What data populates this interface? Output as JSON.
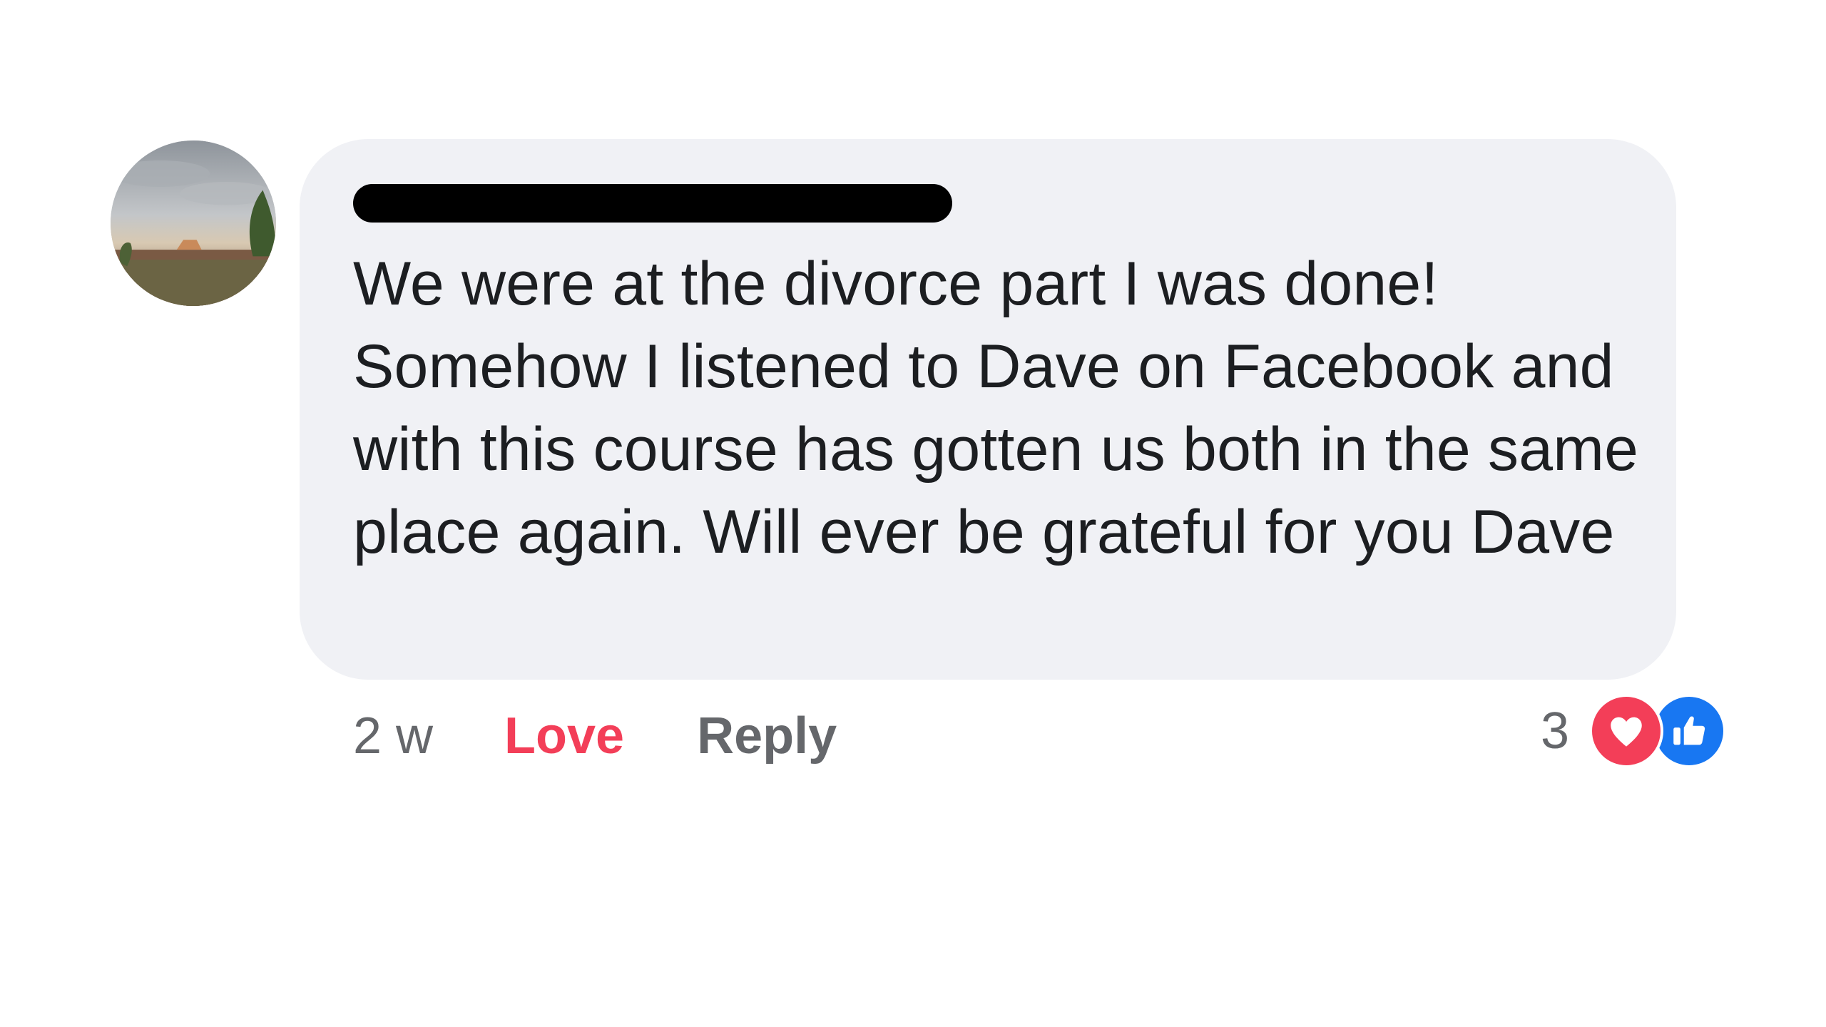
{
  "comment": {
    "author": "",
    "text": "We were at the divorce part I was done! Somehow I listened to Dave on Facebook and with this course has gotten us both in the same place again. Will ever be grateful for you Dave",
    "timestamp": "2 w",
    "love_label": "Love",
    "reply_label": "Reply",
    "reaction_count": "3",
    "reactions": [
      "heart-icon",
      "like-icon"
    ]
  },
  "colors": {
    "bubble": "#f0f1f5",
    "text": "#1c1e21",
    "secondary": "#65676b",
    "love": "#f33e58",
    "like": "#1877f2"
  }
}
